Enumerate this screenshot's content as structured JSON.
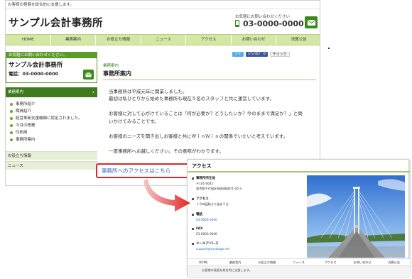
{
  "site": {
    "tagline": "お客様の発展を総合的に支援します。",
    "logo": "サンプル会計事務所",
    "contact_label": "お気軽にお問い合わせください",
    "phone": "03-0000-0000"
  },
  "nav": [
    "HOME",
    "業務案内",
    "お役立ち情報",
    "ニュース",
    "アクセス",
    "お問い合わせ",
    "決算公告"
  ],
  "sidebar": {
    "box_head": "お気軽にお問い合わせください。",
    "name": "サンプル会計事務所",
    "tel": "電話：03-0000-0000",
    "category": "業務案内",
    "items": [
      "事務所紹介",
      "職員紹介",
      "経営革新支援機関に認定されました。",
      "今月の税務",
      "印刷用",
      "事務所案内"
    ],
    "links": [
      "お役立ち情報",
      "ニュース"
    ]
  },
  "share": {
    "tweet": "ツイ",
    "like": "いいね！ 0",
    "check": "チェック"
  },
  "content": {
    "crumb": "業務案内",
    "title": "事務所案内",
    "p1": "当事務所は平成元年に開業しました。",
    "p2": "最初は私ひとりから始めた事務所も現在５名のスタッフと共に運営しています。",
    "p3": "お客様に対して心がけていることは「何が必要か？どうしたいか？今のままで満足か？」と問",
    "p4": "いかけてみることです。",
    "p5": "お客様のニーズを聞き出しお客様と共にＷｉｎＷｉｎの関係でいたいと考えています。",
    "p6": "一度事務所へお越しください。その意味がわかります。",
    "access_link": "事務所へのアクセスはこちら"
  },
  "inset": {
    "title": "アクセス",
    "sections": [
      {
        "label": "事務所所在地",
        "lines": [
          "〒101-0041",
          "東京都千代田区神田須田町1-26-3"
        ],
        "blue": []
      },
      {
        "label": "アクセス",
        "lines": [
          "ＪＲ神田駅より徒歩５分"
        ],
        "blue": []
      },
      {
        "label": "電話",
        "lines": [],
        "blue": [
          "03-0000-0000"
        ]
      },
      {
        "label": "FAX",
        "lines": [
          "03-0000-0000"
        ],
        "blue": []
      },
      {
        "label": "メールアドレス",
        "lines": [],
        "blue": [
          "support@sunkaigo.net"
        ]
      }
    ],
    "nav": [
      "HOME",
      "業務案内",
      "お役立ち情報",
      "ニュース",
      "アクセス",
      "お問い合わせ",
      "決算公告"
    ],
    "footer": "お客様の発展を総合的に支援します。"
  },
  "colors": {
    "accent_green": "#3b8a1c",
    "nav_bg": "#d6e6a5",
    "link_blue": "#2a6cc4",
    "highlight_red": "#e02828"
  }
}
